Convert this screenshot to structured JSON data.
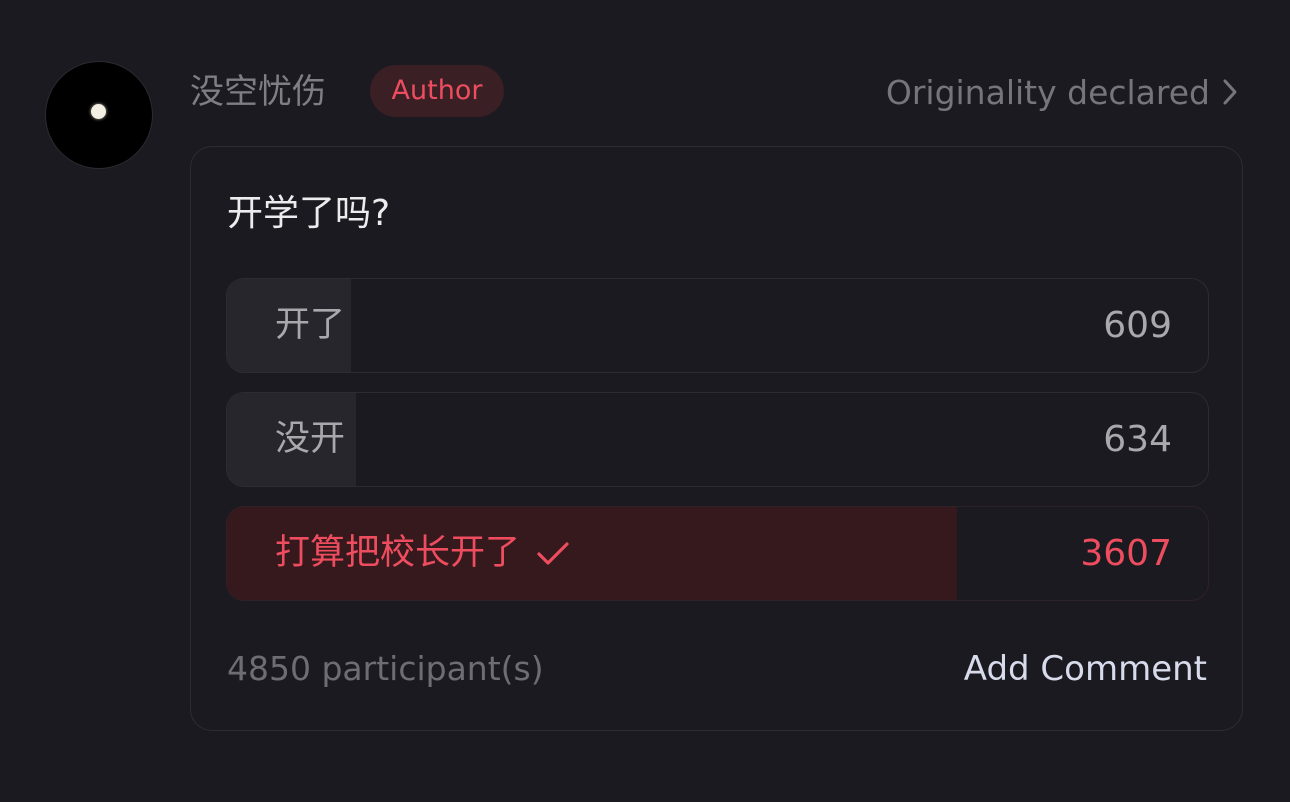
{
  "post": {
    "username": "没空忧伤",
    "author_badge": "Author",
    "originality": "Originality declared"
  },
  "poll": {
    "question": "开学了吗?",
    "options": [
      {
        "label": "开了",
        "count": "609",
        "share": 0.126,
        "selected": false
      },
      {
        "label": "没开",
        "count": "634",
        "share": 0.131,
        "selected": false
      },
      {
        "label": "打算把校长开了",
        "count": "3607",
        "share": 0.744,
        "selected": true
      }
    ],
    "participants": "4850 participant(s)",
    "add_comment": "Add Comment"
  },
  "colors": {
    "accent": "#ee4d5f",
    "background": "#1b1a20",
    "option_fill": "#27262c",
    "selected_fill": "#35191d"
  },
  "icons": {
    "avatar": "moon-avatar",
    "originality": "chevron-right-icon",
    "selected": "check-icon"
  }
}
